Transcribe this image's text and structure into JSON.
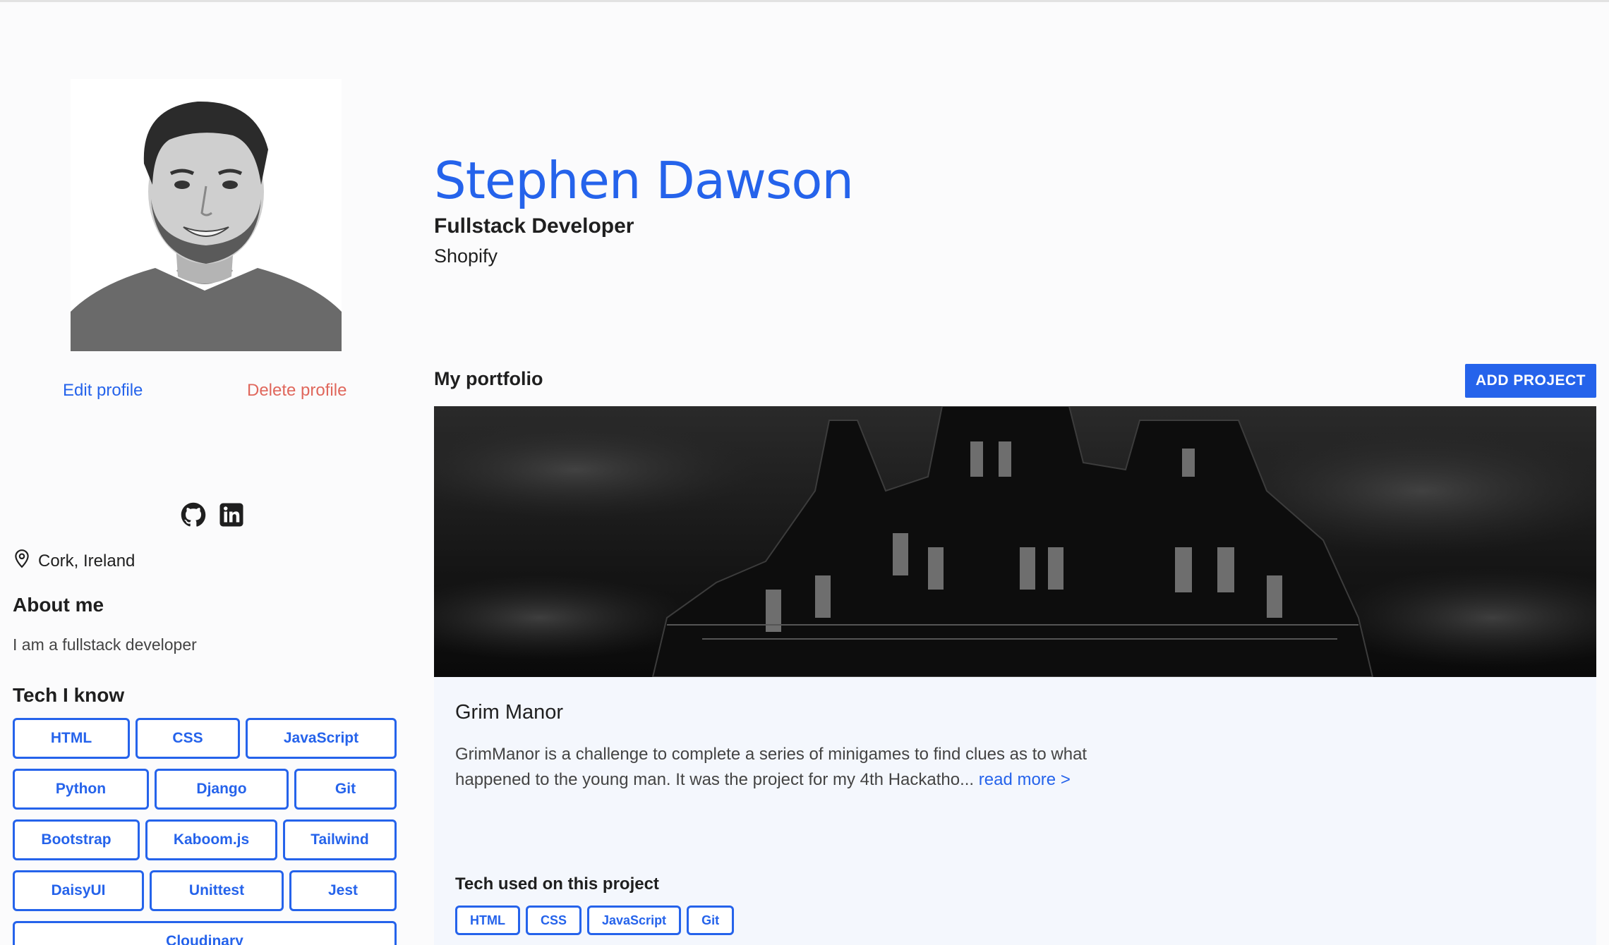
{
  "profile": {
    "name": "Stephen Dawson",
    "role": "Fullstack Developer",
    "company": "Shopify",
    "edit_label": "Edit profile",
    "delete_label": "Delete profile",
    "location": "Cork, Ireland"
  },
  "social": {
    "icons": [
      "github-icon",
      "linkedin-icon"
    ]
  },
  "about": {
    "heading": "About me",
    "text": "I am a fullstack developer"
  },
  "tech": {
    "heading": "Tech I know",
    "items": [
      "HTML",
      "CSS",
      "JavaScript",
      "Python",
      "Django",
      "Git",
      "Bootstrap",
      "Kaboom.js",
      "Tailwind",
      "DaisyUI",
      "Unittest",
      "Jest",
      "Cloudinary"
    ]
  },
  "portfolio": {
    "heading": "My portfolio",
    "add_label": "ADD PROJECT",
    "project": {
      "title": "Grim Manor",
      "description": "GrimManor is a challenge to complete a series of minigames to find clues as to what happened to the young man. It was the project for my 4th Hackatho...",
      "read_more": "read more >",
      "tech_heading": "Tech used on this project",
      "tech": [
        "HTML",
        "CSS",
        "JavaScript",
        "Git"
      ]
    }
  },
  "colors": {
    "accent": "#2563eb",
    "danger": "#e0675c"
  }
}
